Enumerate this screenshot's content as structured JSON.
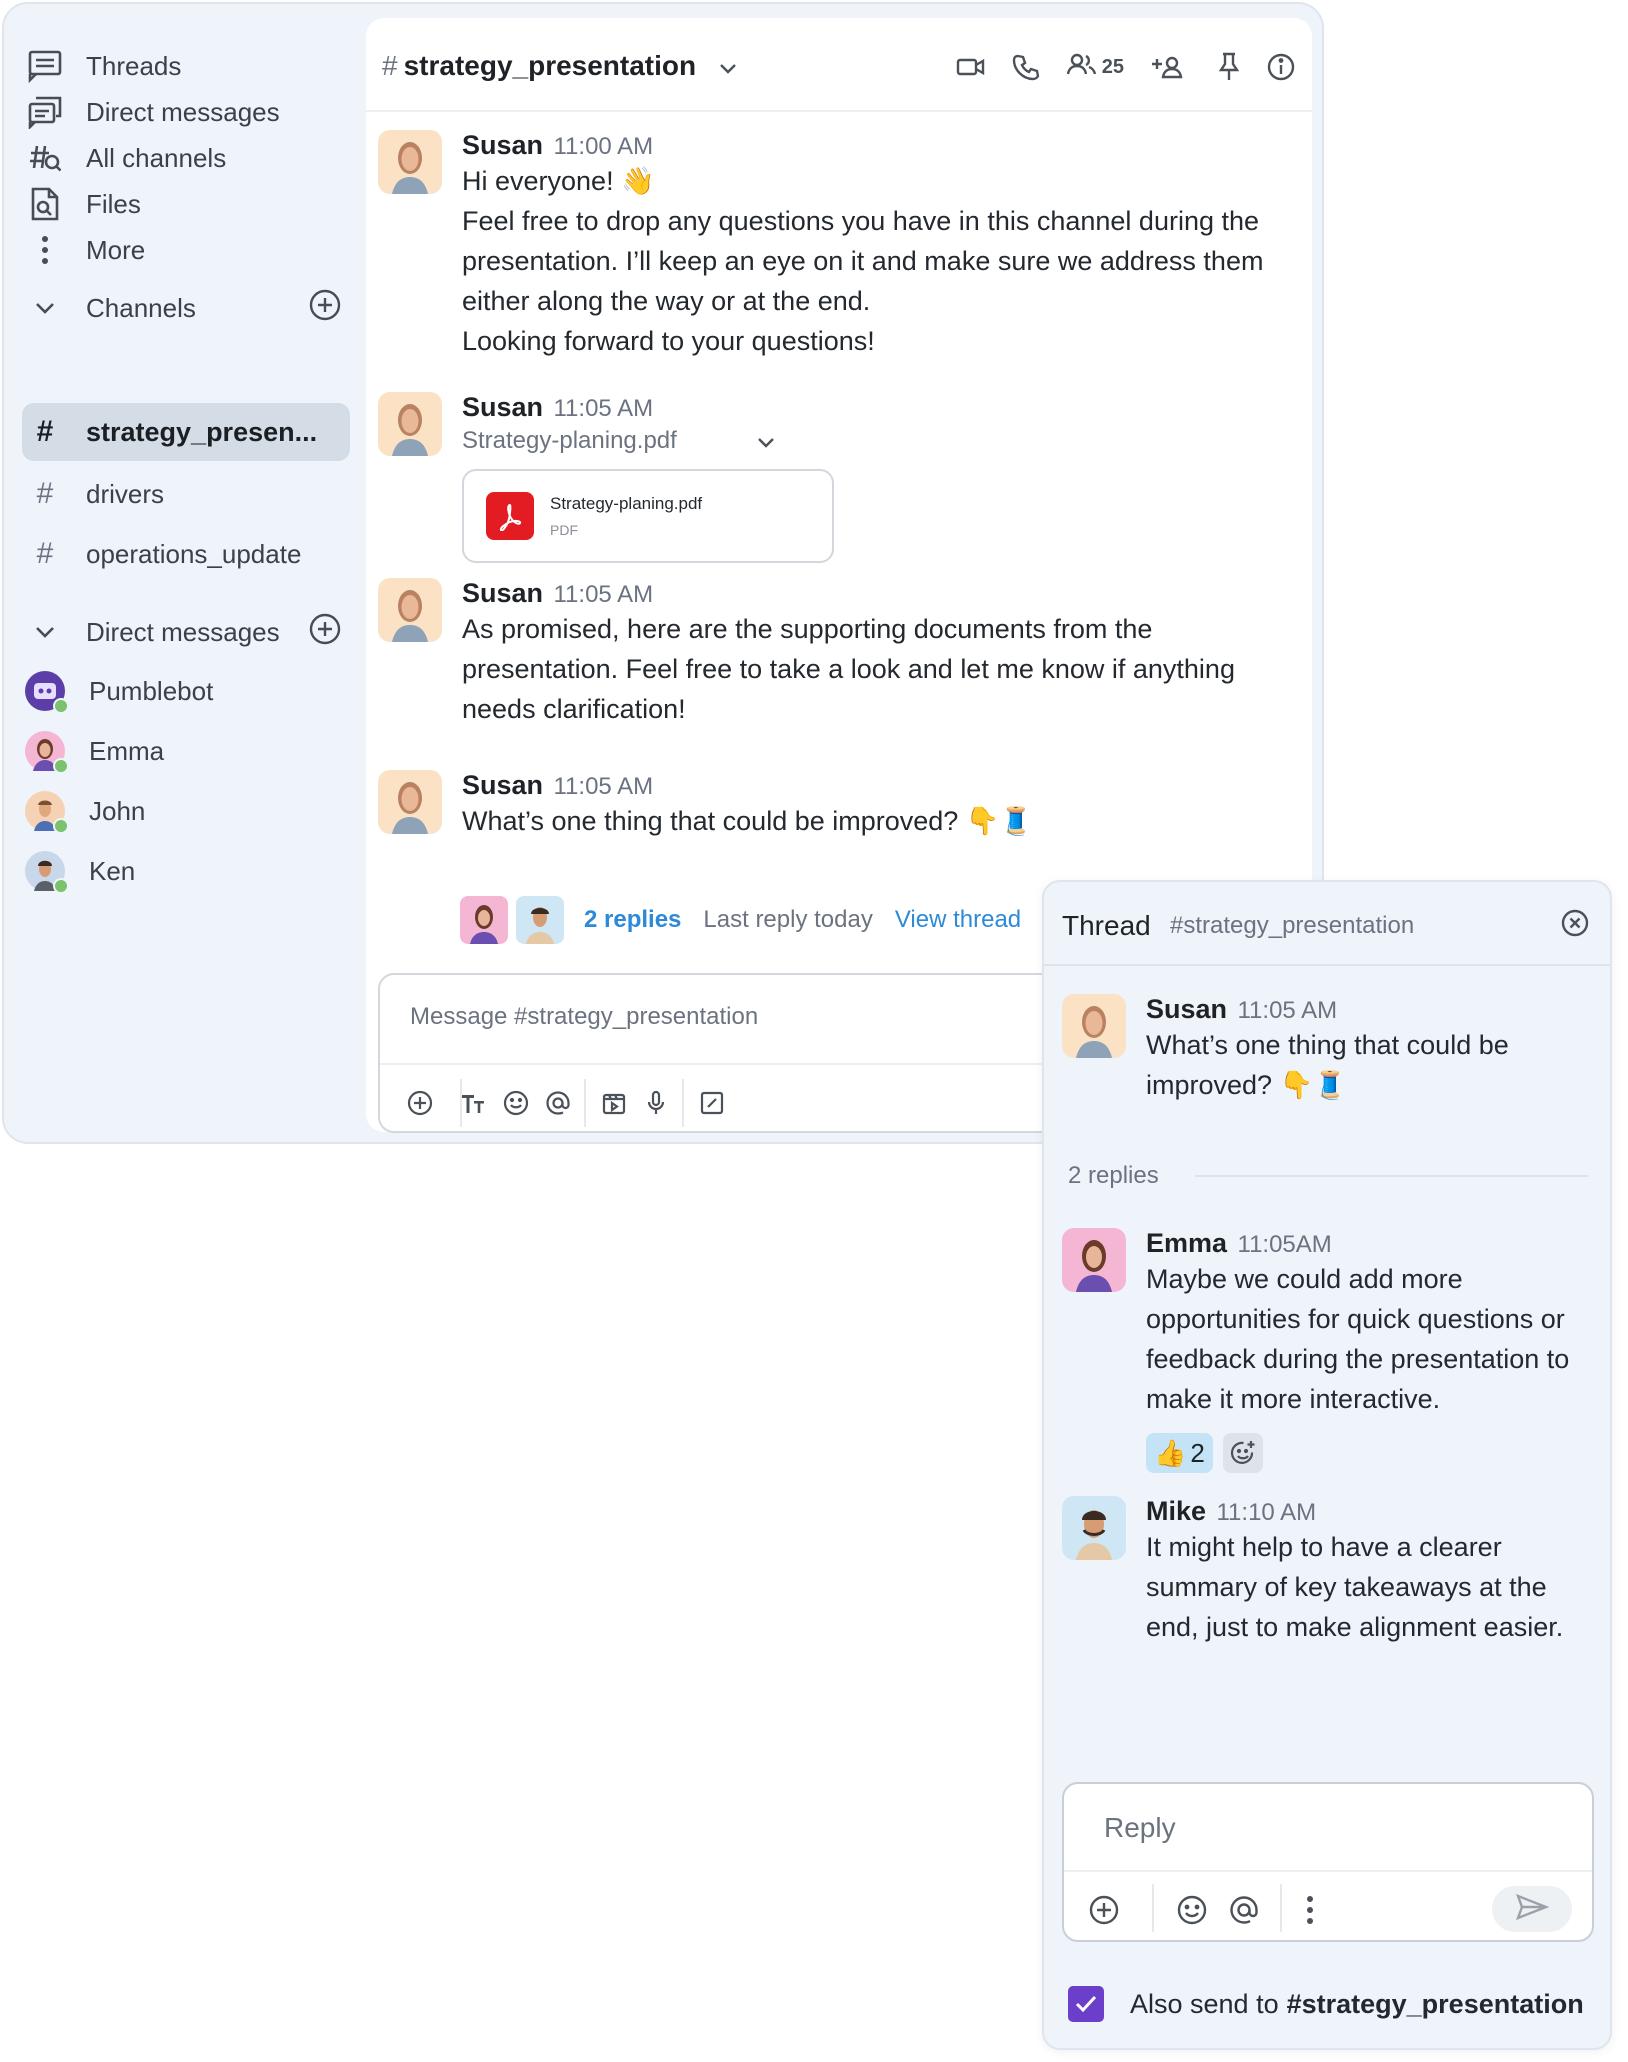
{
  "sidebar": {
    "nav": [
      {
        "label": "Threads",
        "icon": "threads-icon"
      },
      {
        "label": "Direct messages",
        "icon": "direct-messages-icon"
      },
      {
        "label": "All channels",
        "icon": "all-channels-icon"
      },
      {
        "label": "Files",
        "icon": "files-icon"
      },
      {
        "label": "More",
        "icon": "more-vertical-icon"
      }
    ],
    "channels_heading": "Channels",
    "channels": [
      {
        "label": "strategy_presen...",
        "active": true
      },
      {
        "label": "drivers",
        "active": false
      },
      {
        "label": "operations_update",
        "active": false
      }
    ],
    "dms_heading": "Direct messages",
    "dms": [
      {
        "label": "Pumblebot"
      },
      {
        "label": "Emma"
      },
      {
        "label": "John"
      },
      {
        "label": "Ken"
      }
    ]
  },
  "header": {
    "hash": "#",
    "channel": "strategy_presentation",
    "member_count": "25"
  },
  "messages": [
    {
      "author": "Susan",
      "time": "11:00 AM",
      "lines": [
        "Hi everyone! 👋",
        "Feel free to drop any questions you have in this channel during the presentation. I’ll keep an eye on it and make sure we address them either along the way or at the end.",
        "Looking forward to your questions!"
      ]
    },
    {
      "author": "Susan",
      "time": "11:05 AM",
      "file_label": "Strategy-planing.pdf",
      "file_name": "Strategy-planing.pdf",
      "file_type": "PDF"
    },
    {
      "author": "Susan",
      "time": "11:05 AM",
      "text": "As promised, here are the supporting documents from the presentation. Feel free to take a look and let me know if anything needs clarification!"
    },
    {
      "author": "Susan",
      "time": "11:05 AM",
      "text": "What’s one thing that could be improved? 👇🧵",
      "replies": "2 replies",
      "last_reply": "Last reply today",
      "view_thread": "View thread"
    }
  ],
  "composer": {
    "placeholder": "Message #strategy_presentation"
  },
  "thread": {
    "title": "Thread",
    "channel": "#strategy_presentation",
    "root": {
      "author": "Susan",
      "time": "11:05 AM",
      "text": "What’s one thing that could be improved? 👇🧵"
    },
    "replies_count": "2 replies",
    "replies": [
      {
        "author": "Emma",
        "time": "11:05AM",
        "text": "Maybe we could add more opportunities for quick questions or feedback during the presentation to make it more interactive.",
        "reaction_emoji": "👍",
        "reaction_count": "2"
      },
      {
        "author": "Mike",
        "time": "11:10 AM",
        "text": "It might help to have a clearer summary of key takeaways at the end, just to make alignment easier."
      }
    ],
    "reply_placeholder": "Reply",
    "also_send_label": "Also send to",
    "also_send_channel": "#strategy_presentation",
    "also_send_checked": true
  },
  "colors": {
    "accent_link": "#2d8ad8",
    "checkbox": "#6b3fc9",
    "online": "#7ac26c",
    "pdf": "#e31b23",
    "sidebar_bg": "#eef4fa"
  }
}
